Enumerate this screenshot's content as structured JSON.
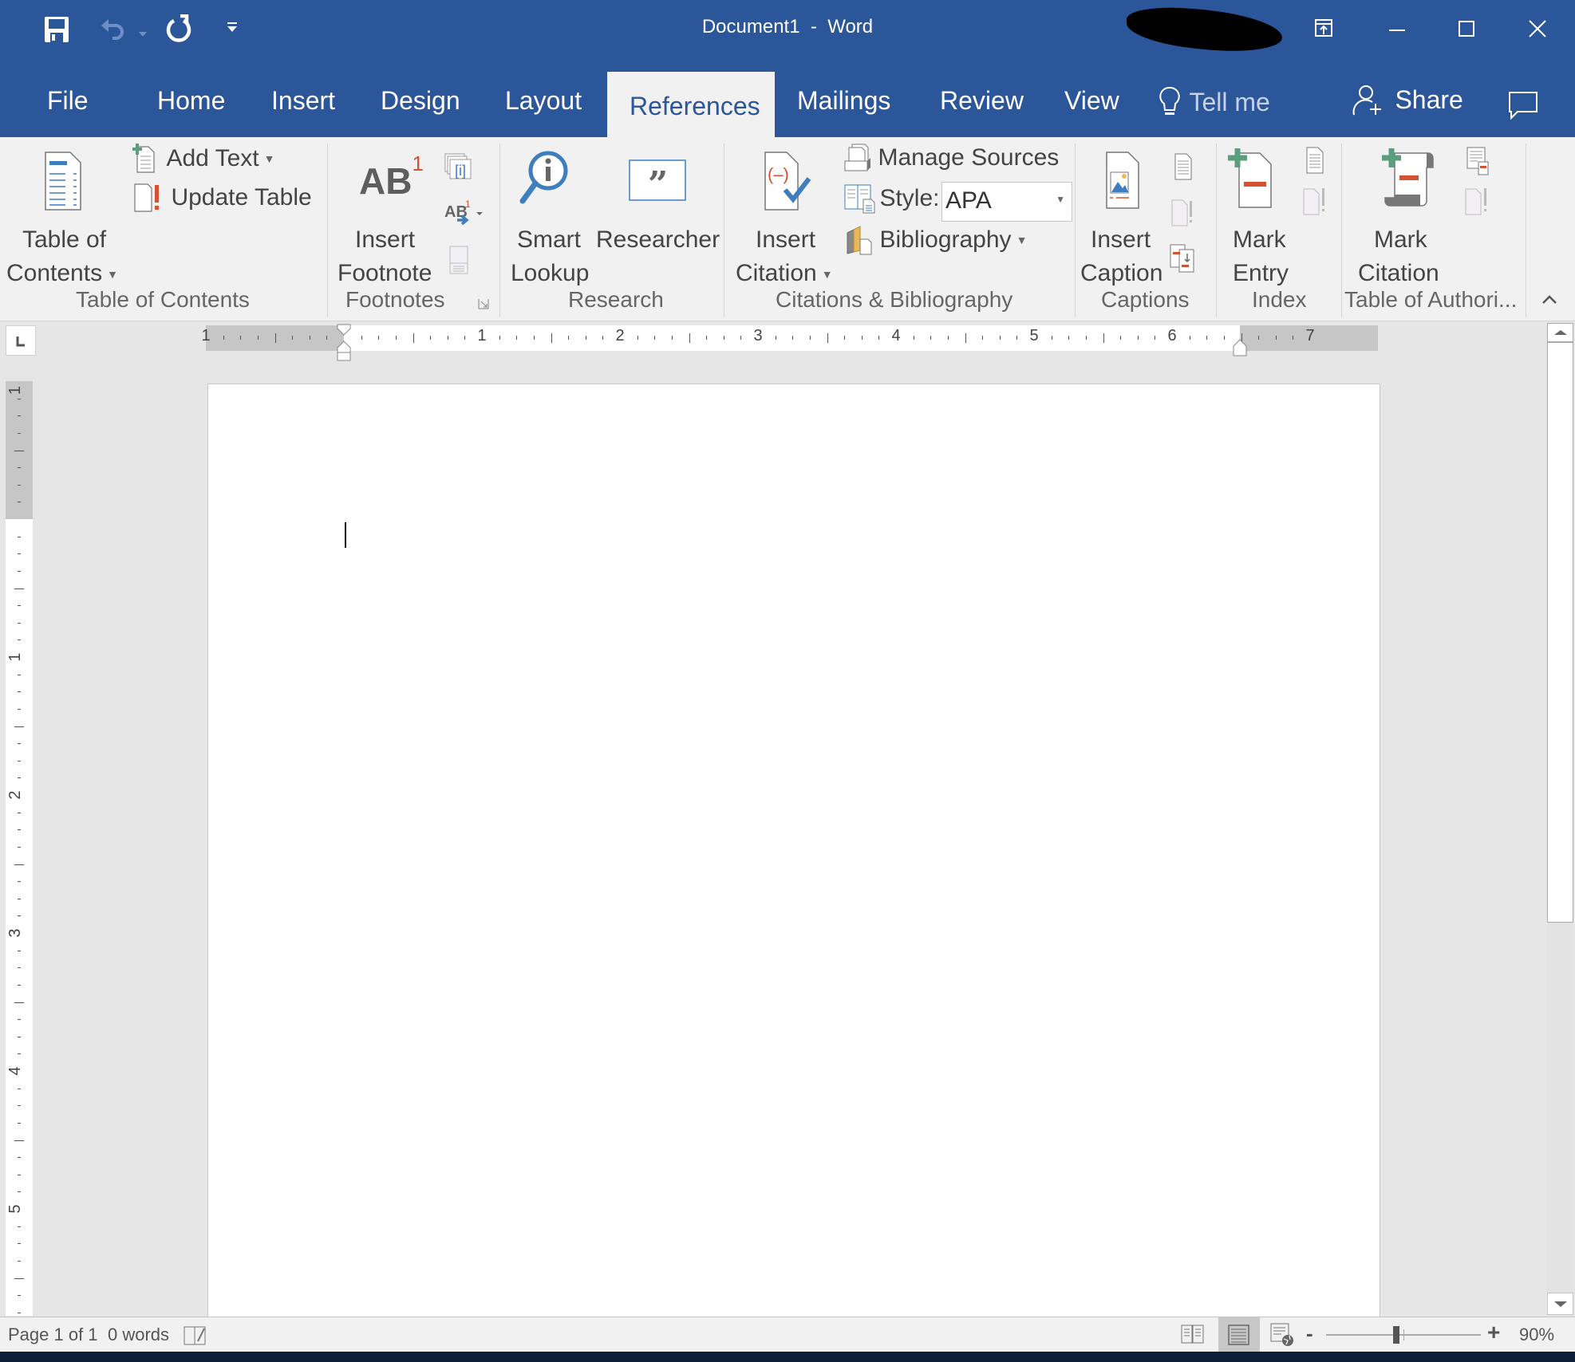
{
  "window": {
    "title": "Document1  -  Word",
    "controls": [
      "ribbon-display-options",
      "minimize",
      "maximize",
      "close"
    ]
  },
  "quick_access": {
    "items": [
      "save",
      "undo",
      "redo",
      "customize"
    ]
  },
  "tabs": [
    {
      "label": "File"
    },
    {
      "label": "Home"
    },
    {
      "label": "Insert"
    },
    {
      "label": "Design"
    },
    {
      "label": "Layout"
    },
    {
      "label": "References",
      "active": true
    },
    {
      "label": "Mailings"
    },
    {
      "label": "Review"
    },
    {
      "label": "View"
    }
  ],
  "tell_me": "Tell me",
  "share": "Share",
  "ribbon": {
    "toc": {
      "group_label": "Table of Contents",
      "toc_button": [
        "Table of",
        "Contents"
      ],
      "add_text": "Add Text",
      "update_table": "Update Table"
    },
    "footnotes": {
      "group_label": "Footnotes",
      "insert_footnote": [
        "Insert",
        "Footnote"
      ],
      "ab_icon": "AB",
      "superscript": "1"
    },
    "research": {
      "group_label": "Research",
      "smart_lookup": [
        "Smart",
        "Lookup"
      ],
      "researcher": "Researcher"
    },
    "citations": {
      "group_label": "Citations & Bibliography",
      "insert_citation": [
        "Insert",
        "Citation"
      ],
      "manage_sources": "Manage Sources",
      "style_label": "Style:",
      "style_value": "APA",
      "bibliography": "Bibliography"
    },
    "captions": {
      "group_label": "Captions",
      "insert_caption": [
        "Insert",
        "Caption"
      ]
    },
    "index": {
      "group_label": "Index",
      "mark_entry": [
        "Mark",
        "Entry"
      ]
    },
    "toa": {
      "group_label": "Table of Authori...",
      "mark_citation": [
        "Mark",
        "Citation"
      ]
    }
  },
  "ruler": {
    "horizontal_labels": [
      "1",
      "1",
      "2",
      "3",
      "4",
      "5",
      "6",
      "7"
    ],
    "vertical_labels": [
      "1",
      "1",
      "2",
      "3",
      "4",
      "5"
    ]
  },
  "status": {
    "page": "Page 1 of 1",
    "words": "0 words",
    "zoom": "90%",
    "zoom_minus": "-",
    "zoom_plus": "+"
  },
  "colors": {
    "accent": "#2b579a",
    "ribbon_bg": "#f1f1f1",
    "canvas_bg": "#e6e6e6",
    "red_accent": "#d35230",
    "green_accent": "#5a9e7d",
    "icon_blue": "#3e7ebf"
  }
}
